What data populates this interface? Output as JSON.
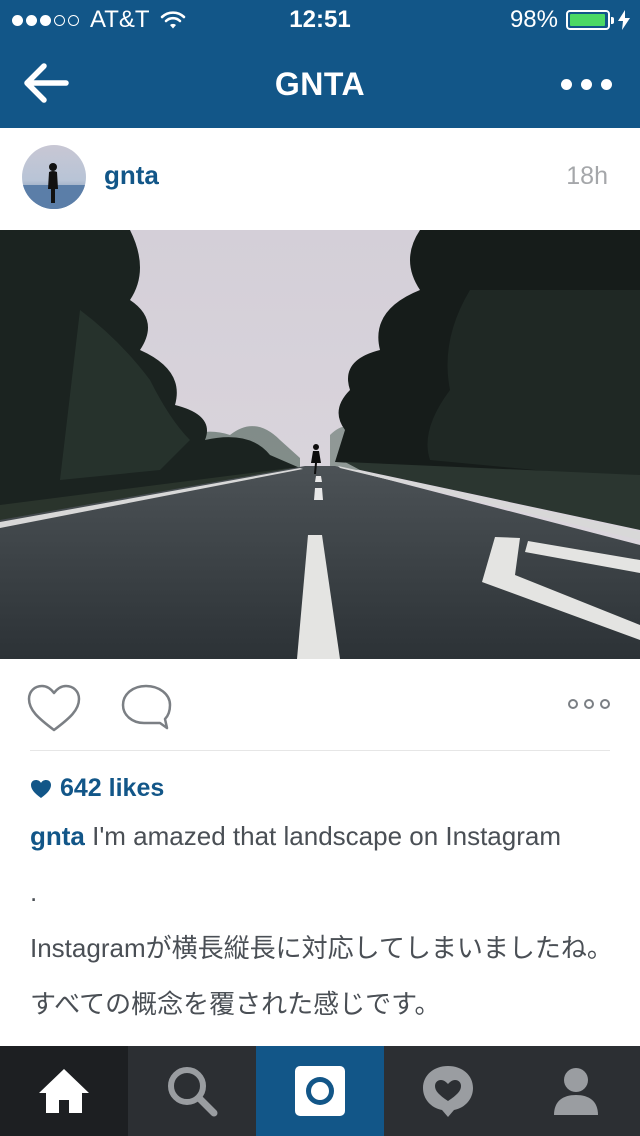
{
  "status_bar": {
    "signal_dots_filled": 3,
    "signal_dots_total": 5,
    "carrier": "AT&T",
    "time": "12:51",
    "battery_percent": "98%",
    "battery_level": 0.98,
    "wifi_icon": "wifi-icon",
    "charging_icon": "bolt-icon"
  },
  "nav": {
    "title": "GNTA",
    "back_icon": "back-arrow-icon",
    "more_icon": "more-dots-icon"
  },
  "post": {
    "username": "gnta",
    "time_ago": "18h",
    "likes_count": "642 likes",
    "caption_user": "gnta",
    "caption_text": " I'm amazed that landscape on Instagram",
    "caption_lines": [
      ".",
      "Instagramが横長縦長に対応してしまいましたね。",
      "すべての概念を覆された感じです。"
    ]
  },
  "tabs": [
    {
      "name": "home",
      "icon": "home-icon",
      "active": true
    },
    {
      "name": "search",
      "icon": "search-icon",
      "active": false
    },
    {
      "name": "camera",
      "icon": "camera-icon",
      "active": false
    },
    {
      "name": "activity",
      "icon": "heart-bubble-icon",
      "active": false
    },
    {
      "name": "profile",
      "icon": "profile-icon",
      "active": false
    }
  ],
  "colors": {
    "brand_blue": "#125688",
    "tabbar_bg": "#2c2f33",
    "battery_green": "#4cd964"
  }
}
